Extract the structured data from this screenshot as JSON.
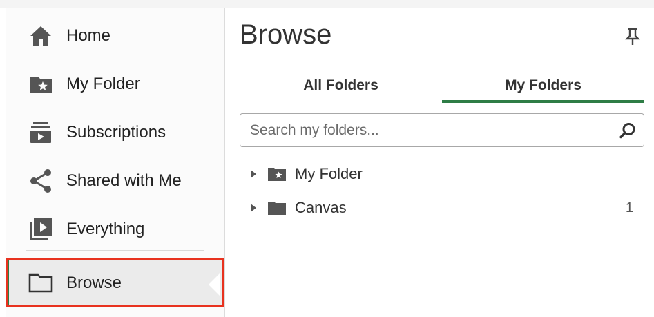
{
  "sidebar": {
    "items": [
      {
        "label": "Home",
        "icon": "home-icon"
      },
      {
        "label": "My Folder",
        "icon": "folder-star-icon"
      },
      {
        "label": "Subscriptions",
        "icon": "subscriptions-icon"
      },
      {
        "label": "Shared with Me",
        "icon": "share-icon"
      },
      {
        "label": "Everything",
        "icon": "video-library-icon"
      },
      {
        "label": "Browse",
        "icon": "folder-outline-icon",
        "selected": true
      }
    ]
  },
  "main": {
    "title": "Browse",
    "tabs": [
      {
        "label": "All Folders",
        "active": false
      },
      {
        "label": "My Folders",
        "active": true
      }
    ],
    "search": {
      "placeholder": "Search my folders...",
      "value": ""
    },
    "tree": [
      {
        "label": "My Folder",
        "icon": "folder-star-icon",
        "count": ""
      },
      {
        "label": "Canvas",
        "icon": "folder-icon",
        "count": "1"
      }
    ]
  },
  "colors": {
    "accent": "#2e7d46",
    "highlight": "#e8321f",
    "icon": "#555555"
  }
}
